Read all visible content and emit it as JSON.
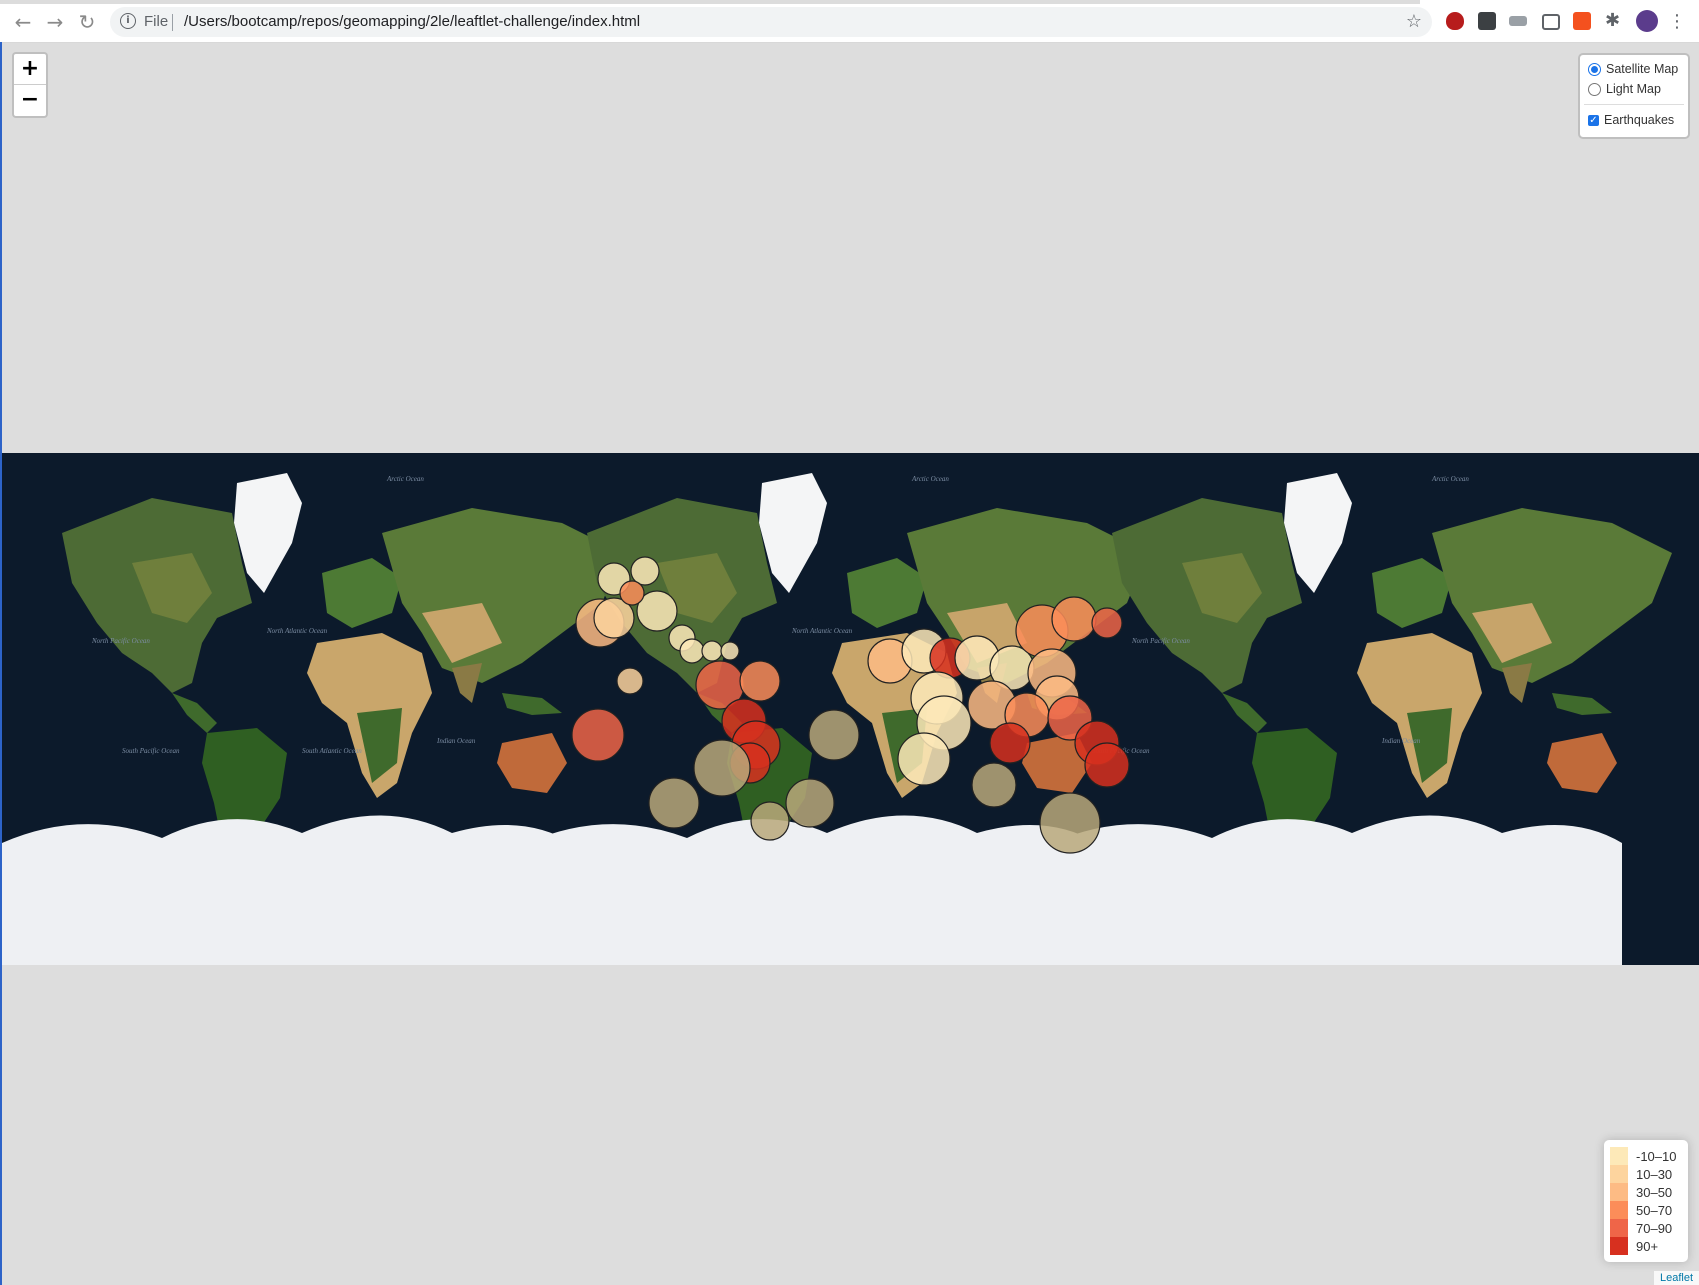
{
  "browser": {
    "file_label": "File",
    "url": "/Users/bootcamp/repos/geomapping/2le/leaftlet-challenge/index.html"
  },
  "zoom": {
    "in_label": "+",
    "out_label": "−"
  },
  "layers_control": {
    "base_layers": [
      {
        "label": "Satellite Map",
        "selected": true
      },
      {
        "label": "Light Map",
        "selected": false
      }
    ],
    "overlays": [
      {
        "label": "Earthquakes",
        "checked": true
      }
    ]
  },
  "map": {
    "ocean_labels": [
      "Arctic Ocean",
      "North Pacific Ocean",
      "North Atlantic Ocean",
      "South Pacific Ocean",
      "South Atlantic Ocean",
      "Indian Ocean"
    ],
    "colors": {
      "ocean": "#0c1a2b",
      "land": "#3d5a2a",
      "desert": "#c9a66b",
      "ice": "#eef0f3"
    }
  },
  "legend": {
    "items": [
      {
        "label": "-10–10",
        "color": "#fde9b8"
      },
      {
        "label": "10–30",
        "color": "#fdd49e"
      },
      {
        "label": "30–50",
        "color": "#fdbb84"
      },
      {
        "label": "50–70",
        "color": "#fc8d59"
      },
      {
        "label": "70–90",
        "color": "#ef6548"
      },
      {
        "label": "90+",
        "color": "#d7301f"
      }
    ]
  },
  "attribution": "Leaflet"
}
